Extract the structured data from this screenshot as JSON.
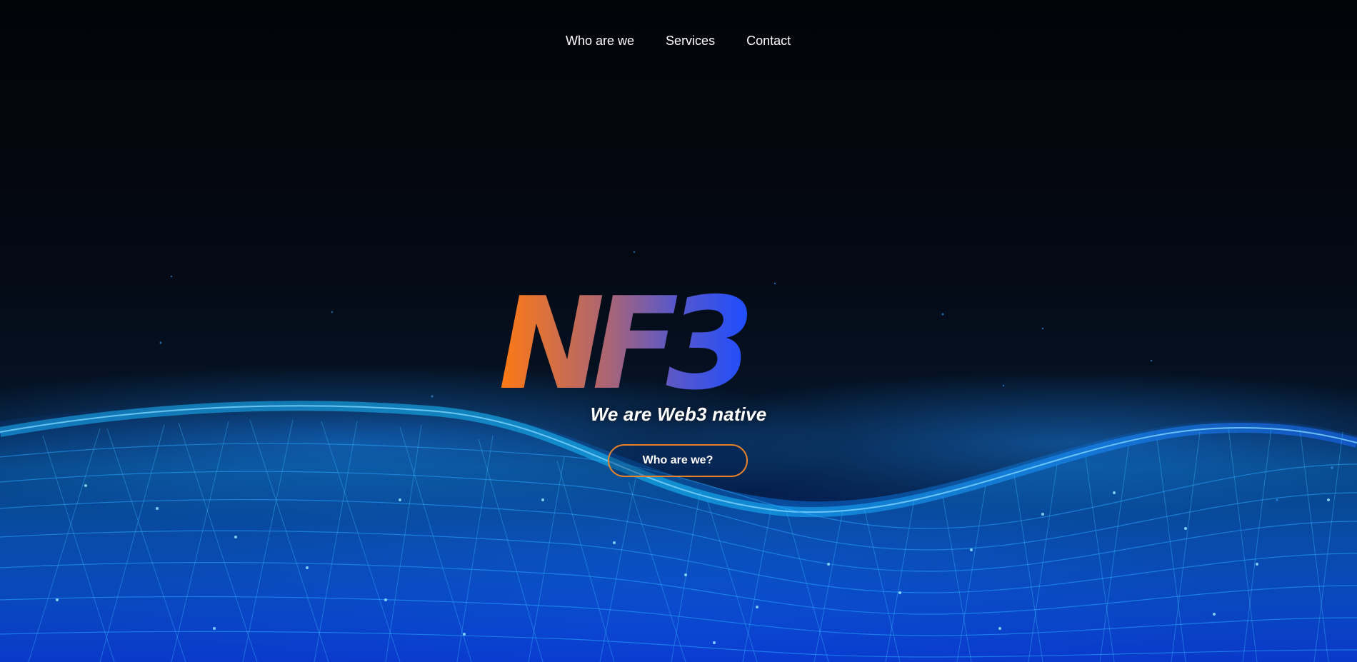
{
  "nav": {
    "items": [
      {
        "label": "Who are we"
      },
      {
        "label": "Services"
      },
      {
        "label": "Contact"
      }
    ]
  },
  "hero": {
    "logo_text": "NF3",
    "tagline": "We are Web3 native",
    "cta_label": "Who are we?"
  },
  "colors": {
    "background": "#03050b",
    "logo_gradient_start": "#ff7a12",
    "logo_gradient_end": "#1f4dff",
    "cta_border": "#e8832a",
    "wave": "#1aa8ff"
  },
  "icons": {
    "background": "network-mesh-wave"
  }
}
